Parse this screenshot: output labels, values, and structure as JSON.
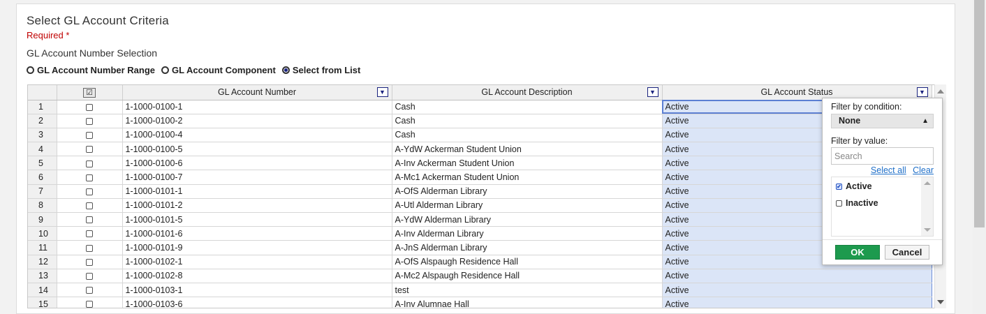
{
  "header": {
    "title": "Select GL Account Criteria",
    "required_label": "Required *",
    "section_label": "GL Account Number Selection"
  },
  "selection_modes": [
    {
      "label": "GL Account Number Range",
      "checked": false
    },
    {
      "label": "GL Account Component",
      "checked": false
    },
    {
      "label": "Select from List",
      "checked": true
    }
  ],
  "grid": {
    "columns": {
      "number": "GL Account Number",
      "description": "GL Account Description",
      "status": "GL Account Status"
    },
    "rows": [
      {
        "n": "1",
        "number": "1-1000-0100-1",
        "description": "Cash",
        "status": "Active"
      },
      {
        "n": "2",
        "number": "1-1000-0100-2",
        "description": "Cash",
        "status": "Active"
      },
      {
        "n": "3",
        "number": "1-1000-0100-4",
        "description": "Cash",
        "status": "Active"
      },
      {
        "n": "4",
        "number": "1-1000-0100-5",
        "description": "A-YdW Ackerman Student Union",
        "status": "Active"
      },
      {
        "n": "5",
        "number": "1-1000-0100-6",
        "description": "A-Inv Ackerman Student Union",
        "status": "Active"
      },
      {
        "n": "6",
        "number": "1-1000-0100-7",
        "description": "A-Mc1 Ackerman Student Union",
        "status": "Active"
      },
      {
        "n": "7",
        "number": "1-1000-0101-1",
        "description": "A-OfS Alderman Library",
        "status": "Active"
      },
      {
        "n": "8",
        "number": "1-1000-0101-2",
        "description": "A-Utl Alderman Library",
        "status": "Active"
      },
      {
        "n": "9",
        "number": "1-1000-0101-5",
        "description": "A-YdW Alderman Library",
        "status": "Active"
      },
      {
        "n": "10",
        "number": "1-1000-0101-6",
        "description": "A-Inv Alderman Library",
        "status": "Active"
      },
      {
        "n": "11",
        "number": "1-1000-0101-9",
        "description": "A-JnS Alderman Library",
        "status": "Active"
      },
      {
        "n": "12",
        "number": "1-1000-0102-1",
        "description": "A-OfS Alspaugh Residence Hall",
        "status": "Active"
      },
      {
        "n": "13",
        "number": "1-1000-0102-8",
        "description": "A-Mc2 Alspaugh Residence Hall",
        "status": "Active"
      },
      {
        "n": "14",
        "number": "1-1000-0103-1",
        "description": "test",
        "status": "Active"
      },
      {
        "n": "15",
        "number": "1-1000-0103-6",
        "description": "A-Inv Alumnae Hall",
        "status": "Active"
      }
    ]
  },
  "filter_popup": {
    "condition_label": "Filter by condition:",
    "condition_value": "None",
    "value_label": "Filter by value:",
    "search_placeholder": "Search",
    "select_all": "Select all",
    "clear": "Clear",
    "options": [
      {
        "label": "Active",
        "checked": true
      },
      {
        "label": "Inactive",
        "checked": false
      }
    ],
    "ok_label": "OK",
    "cancel_label": "Cancel"
  },
  "colors": {
    "ok_button": "#1d9a4e",
    "required": "#c00000",
    "status_highlight": "#dbe5f7",
    "link": "#1f6fc8"
  }
}
